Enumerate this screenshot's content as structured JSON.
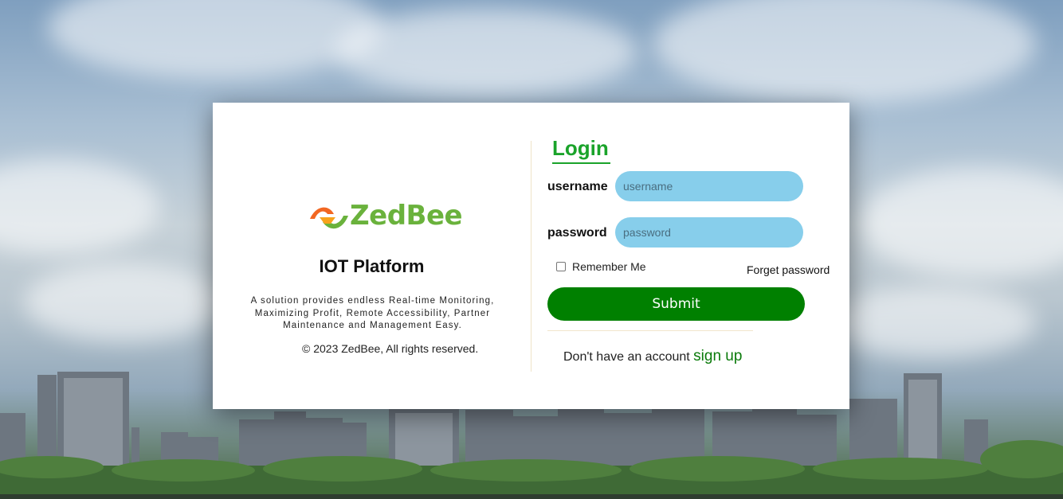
{
  "brand": {
    "logo_text": "ZedBee",
    "colors": {
      "logo_green": "#6ab23c",
      "logo_orange": "#f26722",
      "login_green": "#1aa32a",
      "submit_green": "#008000",
      "input_blue": "#87ceeb"
    }
  },
  "info": {
    "title": "IOT Platform",
    "tagline": "A solution provides endless Real-time Monitoring, Maximizing Profit, Remote Accessibility, Partner Maintenance and Management Easy.",
    "copyright": "© 2023 ZedBee, All rights reserved."
  },
  "login": {
    "heading": "Login",
    "username_label": "username",
    "username_placeholder": "username",
    "username_value": "",
    "password_label": "password",
    "password_placeholder": "password",
    "password_value": "",
    "remember_label": "Remember Me",
    "remember_checked": false,
    "forget_label": "Forget password",
    "submit_label": "Submit",
    "signup_prompt": "Don't have an account",
    "signup_link": "sign up"
  }
}
